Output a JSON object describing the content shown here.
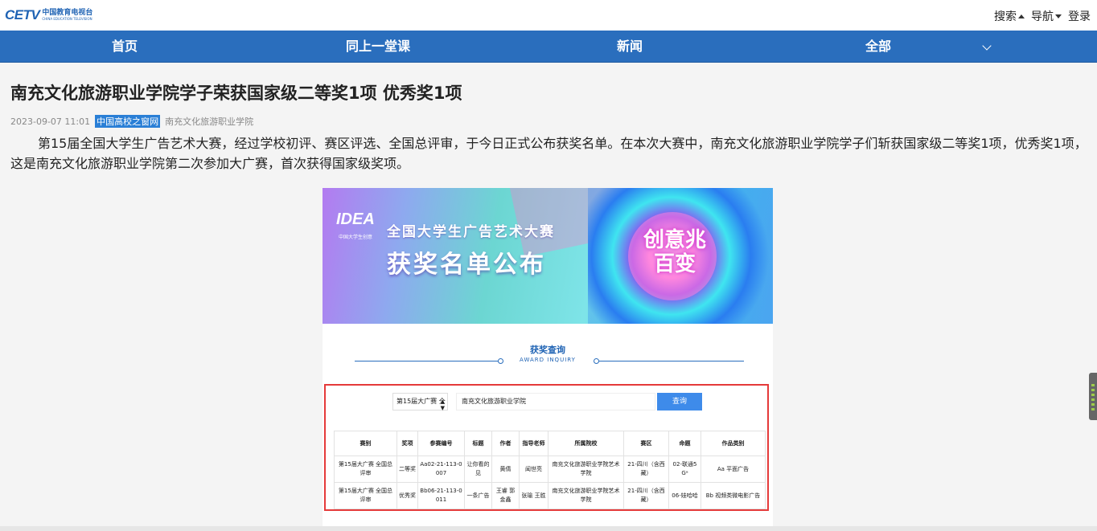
{
  "header": {
    "logo": {
      "brand": "CETV",
      "cn": "中国教育电视台",
      "en": "CHINA EDUCATION TELEVISION"
    },
    "links": [
      {
        "label": "搜索",
        "icon": "triangle-up-icon"
      },
      {
        "label": "导航",
        "icon": "triangle-down-icon"
      },
      {
        "label": "登录"
      }
    ]
  },
  "nav": {
    "items": [
      {
        "label": "首页"
      },
      {
        "label": "同上一堂课"
      },
      {
        "label": "新闻"
      },
      {
        "label": "全部"
      }
    ],
    "more_icon": "chevron-down-icon"
  },
  "article": {
    "title": "南充文化旅游职业学院学子荣获国家级二等奖1项 优秀奖1项",
    "date": "2023-09-07 11:01",
    "source_tag": "中国高校之窗网",
    "author": "南充文化旅游职业学院",
    "body": "第15届全国大学生广告艺术大赛，经过学校初评、赛区评选、全国总评审，于今日正式公布获奖名单。在本次大赛中，南充文化旅游职业学院学子们斩获国家级二等奖1项，优秀奖1项，这是南充文化旅游职业学院第二次参加大广赛，首次获得国家级奖项。"
  },
  "image": {
    "banner": {
      "logo": "IDEA",
      "logo_sub": "中国大学生创意",
      "title1": "全国大学生广告艺术大赛",
      "title2": "获奖名单公布",
      "badge": "创意兆百变"
    },
    "inquiry": {
      "title": "获奖查询",
      "subtitle": "AWARD INQUIRY",
      "select_value": "第15届大广赛 全",
      "search_value": "南充文化旅游职业学院",
      "search_button": "查询"
    },
    "table": {
      "headers": [
        "赛别",
        "奖项",
        "参赛编号",
        "标题",
        "作者",
        "指导老师",
        "所属院校",
        "赛区",
        "命题",
        "作品类别"
      ],
      "rows": [
        [
          "第15届大广赛 全国总评审",
          "二等奖",
          "Aa02-21-113-0007",
          "让你看的见",
          "黄倩",
          "闻世亮",
          "南充文化旅游职业学院艺术学院",
          "21-四川（含西藏）",
          "02-联通5Gᵃ",
          "Aa 平面广告"
        ],
        [
          "第15届大广赛 全国总评审",
          "优秀奖",
          "Bb06-21-113-0011",
          "一条广告",
          "王睿 郭金鑫",
          "张瑜 王胜",
          "南充文化旅游职业学院艺术学院",
          "21-四川（含西藏）",
          "06-娃哈哈",
          "Bb 视频类微电影广告"
        ]
      ]
    }
  },
  "colors": {
    "nav_bg": "#2a6ebd",
    "brand": "#1f63b4",
    "tag_bg": "#2a7fd6",
    "highlight_border": "#e53a3a",
    "button": "#3e8bea"
  }
}
